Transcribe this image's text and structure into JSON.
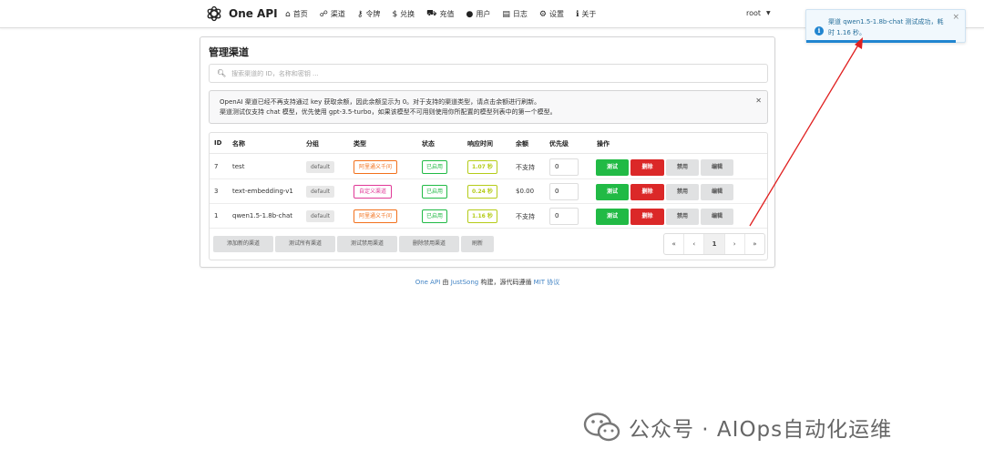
{
  "brand": {
    "name": "One API"
  },
  "nav": [
    {
      "icon": "home-icon",
      "glyph": "⌂",
      "label": "首页"
    },
    {
      "icon": "sitemap-icon",
      "glyph": "☍",
      "label": "渠道"
    },
    {
      "icon": "key-icon",
      "glyph": "⚷",
      "label": "令牌"
    },
    {
      "icon": "dollar-icon",
      "glyph": "$",
      "label": "兑换"
    },
    {
      "icon": "cart-icon",
      "glyph": "⛟",
      "label": "充值"
    },
    {
      "icon": "user-icon",
      "glyph": "●",
      "label": "用户"
    },
    {
      "icon": "book-icon",
      "glyph": "▤",
      "label": "日志"
    },
    {
      "icon": "gear-icon",
      "glyph": "⚙",
      "label": "设置"
    },
    {
      "icon": "info-icon",
      "glyph": "ℹ",
      "label": "关于"
    }
  ],
  "user": {
    "name": "root"
  },
  "toast": {
    "message": "渠道 qwen1.5-1.8b-chat 测试成功，耗时 1.16 秒。"
  },
  "page": {
    "title": "管理渠道",
    "search_placeholder": "搜索渠道的 ID，名称和密钥 ...",
    "notice_line1": "OpenAI 渠道已经不再支持通过 key 获取余额，因此余额显示为 0。对于支持的渠道类型，请点击余额进行刷新。",
    "notice_line2": "渠道测试仅支持 chat 模型，优先使用 gpt-3.5-turbo，如果该模型不可用则使用你所配置的模型列表中的第一个模型。"
  },
  "table": {
    "headers": {
      "id": "ID",
      "name": "名称",
      "group": "分组",
      "type": "类型",
      "status": "状态",
      "time": "响应时间",
      "balance": "余额",
      "priority": "优先级",
      "actions": "操作"
    },
    "rows": [
      {
        "id": "7",
        "name": "test",
        "group": "default",
        "type": "阿里通义千问",
        "type_color": "#f2711c",
        "status": "已启用",
        "time": "1.07 秒",
        "balance": "不支持",
        "priority": "0"
      },
      {
        "id": "3",
        "name": "text-embedding-v1",
        "group": "default",
        "type": "自定义渠道",
        "type_color": "#e03997",
        "status": "已启用",
        "time": "0.24 秒",
        "balance": "$0.00",
        "priority": "0"
      },
      {
        "id": "1",
        "name": "qwen1.5-1.8b-chat",
        "group": "default",
        "type": "阿里通义千问",
        "type_color": "#f2711c",
        "status": "已启用",
        "time": "1.16 秒",
        "balance": "不支持",
        "priority": "0"
      }
    ],
    "row_actions": {
      "test": "测试",
      "delete": "删除",
      "disable": "禁用",
      "edit": "编辑"
    },
    "footer_buttons": [
      "添加新的渠道",
      "测试所有渠道",
      "测试禁用渠道",
      "删除禁用渠道",
      "刷新"
    ],
    "pagination": [
      "«",
      "‹",
      "1",
      "›",
      "»"
    ]
  },
  "footer": {
    "part1": "One API",
    "part2": " 由 ",
    "part3": "JustSong",
    "part4": " 构建，源代码遵循 ",
    "part5": "MIT 协议"
  },
  "watermark": {
    "text": "公众号 · AIOps自动化运维"
  },
  "colors": {
    "green": "#21ba45",
    "red": "#db2828",
    "olive": "#b5cc18",
    "blue": "#2185d0",
    "annotation": "#e02020"
  }
}
